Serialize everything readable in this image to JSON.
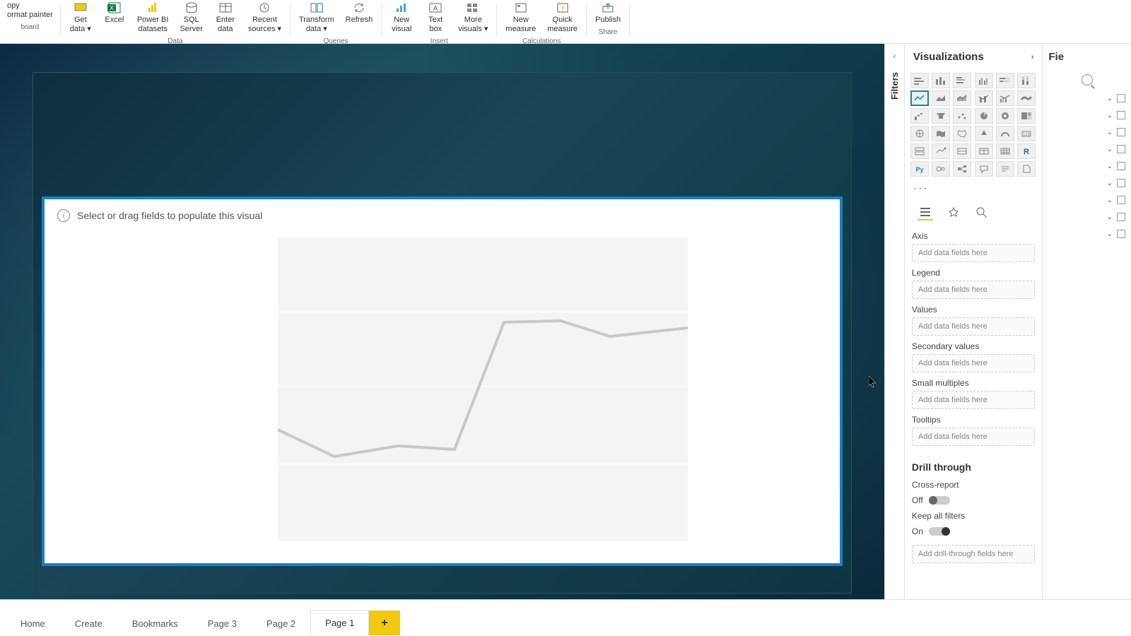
{
  "ribbon": {
    "left_fragments": [
      "opy",
      "ormat painter"
    ],
    "left_group": "board",
    "items": [
      {
        "label": "Get\ndata ▾",
        "group": "Data"
      },
      {
        "label": "Excel",
        "group": "Data"
      },
      {
        "label": "Power BI\ndatasets",
        "group": "Data"
      },
      {
        "label": "SQL\nServer",
        "group": "Data"
      },
      {
        "label": "Enter\ndata",
        "group": "Data"
      },
      {
        "label": "Recent\nsources ▾",
        "group": "Data"
      },
      {
        "label": "Transform\ndata ▾",
        "group": "Queries"
      },
      {
        "label": "Refresh",
        "group": "Queries"
      },
      {
        "label": "New\nvisual",
        "group": "Insert"
      },
      {
        "label": "Text\nbox",
        "group": "Insert"
      },
      {
        "label": "More\nvisuals ▾",
        "group": "Insert"
      },
      {
        "label": "New\nmeasure",
        "group": "Calculations"
      },
      {
        "label": "Quick\nmeasure",
        "group": "Calculations"
      },
      {
        "label": "Publish",
        "group": "Share"
      }
    ],
    "groups": [
      "Data",
      "Queries",
      "Insert",
      "Calculations",
      "Share"
    ]
  },
  "canvas": {
    "hint": "Select or drag fields to populate this visual"
  },
  "filters": {
    "label": "Filters"
  },
  "visualizations": {
    "title": "Visualizations",
    "ellipsis": "···",
    "wells": [
      {
        "label": "Axis",
        "placeholder": "Add data fields here"
      },
      {
        "label": "Legend",
        "placeholder": "Add data fields here"
      },
      {
        "label": "Values",
        "placeholder": "Add data fields here"
      },
      {
        "label": "Secondary values",
        "placeholder": "Add data fields here"
      },
      {
        "label": "Small multiples",
        "placeholder": "Add data fields here"
      },
      {
        "label": "Tooltips",
        "placeholder": "Add data fields here"
      }
    ],
    "drill": {
      "title": "Drill through",
      "cross_report": {
        "label": "Cross-report",
        "state": "Off"
      },
      "keep_filters": {
        "label": "Keep all filters",
        "state": "On"
      },
      "drop": "Add drill-through fields here"
    }
  },
  "fields": {
    "title": "Fie"
  },
  "pages": {
    "tabs": [
      "Home",
      "Create",
      "Bookmarks",
      "Page 3",
      "Page 2",
      "Page 1"
    ],
    "active": "Page 1",
    "add": "+"
  }
}
